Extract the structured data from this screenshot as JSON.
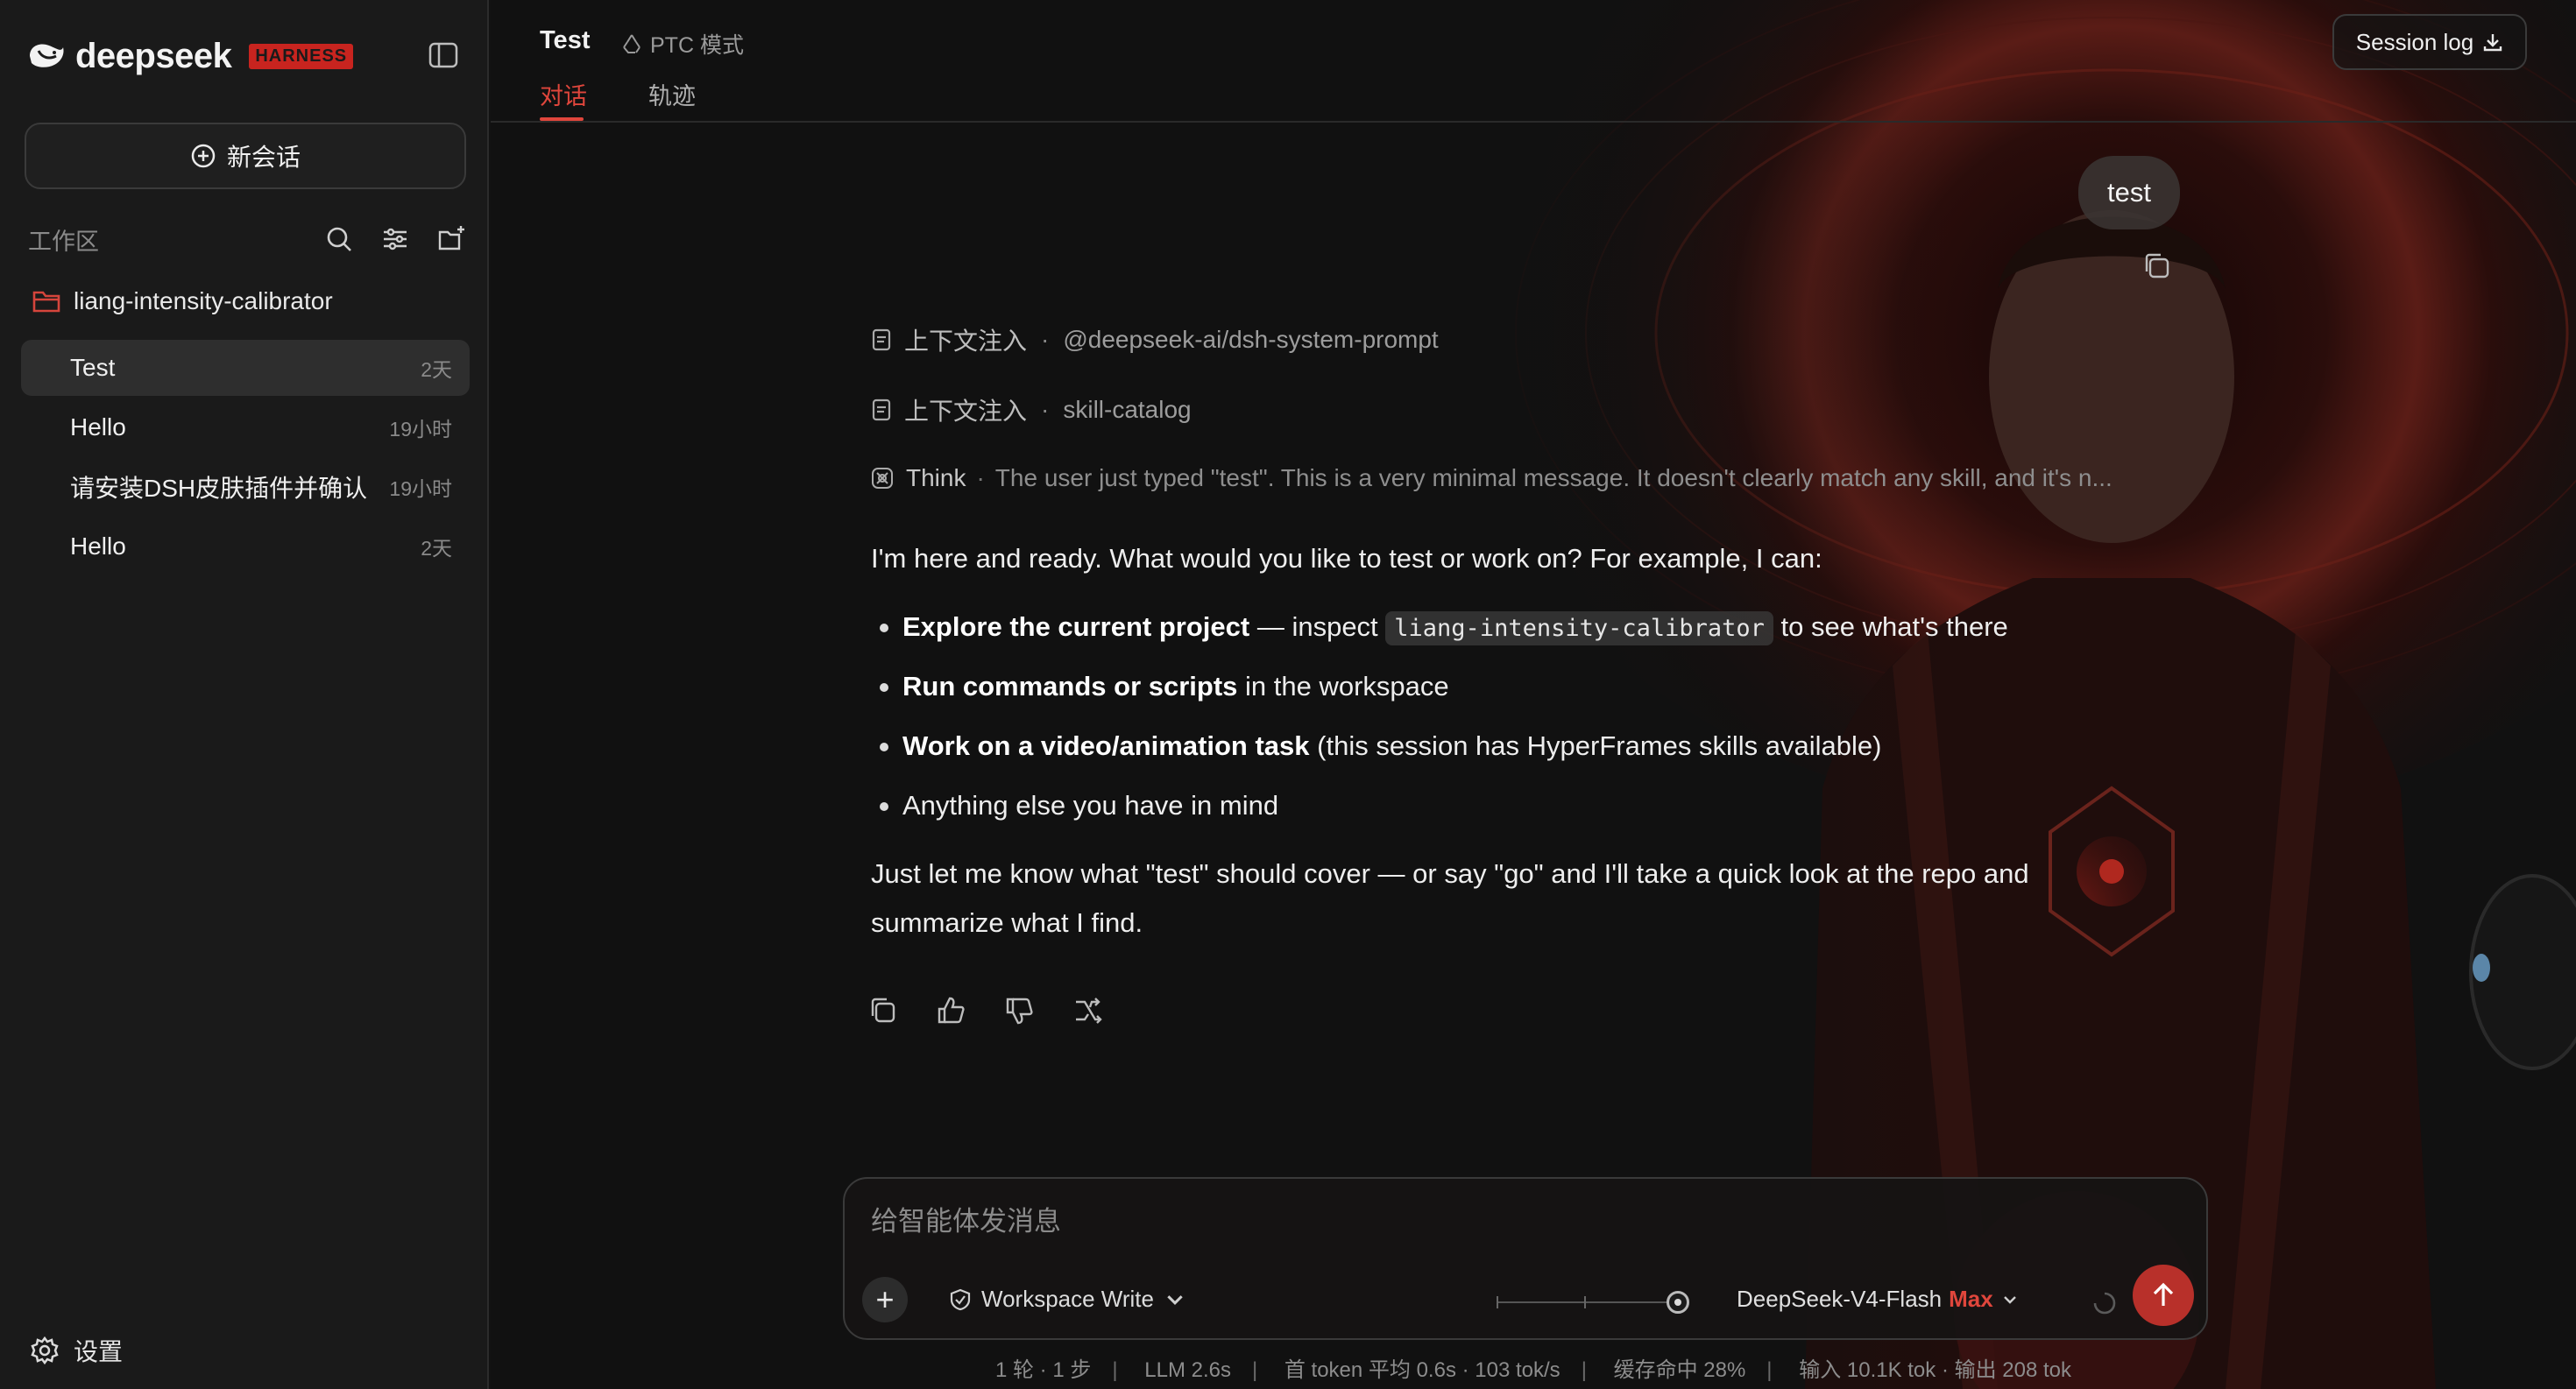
{
  "sidebar": {
    "brand": {
      "name": "deepseek",
      "badge": "HARNESS"
    },
    "new_chat_label": "新会话",
    "workspace_label": "工作区",
    "project": "liang-intensity-calibrator",
    "sessions": [
      {
        "title": "Test",
        "time": "2天",
        "active": true
      },
      {
        "title": "Hello",
        "time": "19小时",
        "active": false
      },
      {
        "title": "请安装DSH皮肤插件并确认",
        "time": "19小时",
        "active": false
      },
      {
        "title": "Hello",
        "time": "2天",
        "active": false
      }
    ],
    "settings_label": "设置"
  },
  "header": {
    "title": "Test",
    "mode": "PTC 模式",
    "tabs": [
      {
        "label": "对话",
        "active": true
      },
      {
        "label": "轨迹",
        "active": false
      }
    ],
    "session_log_label": "Session log"
  },
  "conversation": {
    "user_message": "test",
    "context_injections": [
      {
        "label": "上下文注入",
        "source": "@deepseek-ai/dsh-system-prompt"
      },
      {
        "label": "上下文注入",
        "source": "skill-catalog"
      }
    ],
    "think": {
      "label": "Think",
      "text": "The user just typed \"test\". This is a very minimal message. It doesn't clearly match any skill, and it's n..."
    },
    "answer": {
      "intro": "I'm here and ready. What would you like to test or work on? For example, I can:",
      "bullets": [
        {
          "bold": "Explore the current project",
          "pre": " — inspect ",
          "code": "liang-intensity-calibrator",
          "post": " to see what's there"
        },
        {
          "bold": "Run commands or scripts",
          "rest": " in the workspace"
        },
        {
          "bold": "Work on a video/animation task",
          "rest": " (this session has HyperFrames skills available)"
        },
        {
          "rest": "Anything else you have in mind"
        }
      ],
      "closing": "Just let me know what \"test\" should cover — or say \"go\" and I'll take a quick look at the repo and summarize what I find."
    }
  },
  "composer": {
    "placeholder": "给智能体发消息",
    "value": "",
    "permission": "Workspace Write",
    "model": "DeepSeek-V4-Flash",
    "tier": "Max"
  },
  "stats": {
    "turns": "1 轮 · 1 步",
    "llm": "LLM 2.6s",
    "first_token": "首 token 平均 0.6s · 103 tok/s",
    "cache": "缓存命中 28%",
    "io": "输入 10.1K tok · 输出 208 tok"
  },
  "colors": {
    "accent": "#e0463c",
    "brand_badge": "#c8241f",
    "send": "#b8302a"
  },
  "icons": [
    "whale-logo-icon",
    "sidebar-toggle-icon",
    "plus-circle-icon",
    "search-icon",
    "filter-icon",
    "new-folder-icon",
    "folder-icon",
    "gear-icon",
    "recycle-icon",
    "download-icon",
    "copy-icon",
    "document-icon",
    "think-icon",
    "thumbs-up-icon",
    "thumbs-down-icon",
    "branch-icon",
    "shield-icon",
    "chevron-down-icon",
    "arrow-up-icon"
  ]
}
